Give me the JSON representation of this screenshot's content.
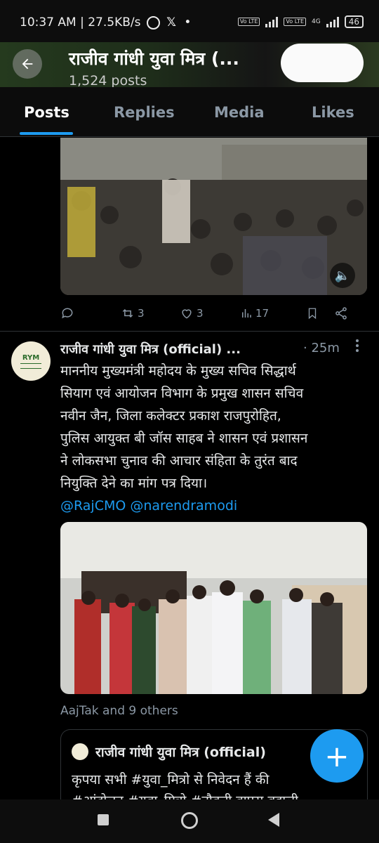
{
  "status_bar": {
    "time_speed": "10:37 AM | 27.5KB/s",
    "whatsapp_icon": "whatsapp-icon",
    "x_icon_glyph": "𝕏",
    "dot": "•",
    "lte1": "Vo LTE",
    "lte2": "Vo LTE",
    "network": "4G",
    "battery": "46"
  },
  "header": {
    "title": "राजीव गांधी युवा मित्र (...",
    "posts_count": "1,524 posts",
    "back_icon": "arrow-left-icon"
  },
  "tabs": [
    {
      "label": "Posts",
      "active": true
    },
    {
      "label": "Replies",
      "active": false
    },
    {
      "label": "Media",
      "active": false
    },
    {
      "label": "Likes",
      "active": false
    }
  ],
  "post1": {
    "reposts": "3",
    "likes": "3",
    "views": "17"
  },
  "post2": {
    "author": "राजीव गांधी युवा मित्र (official) ...",
    "time": "· 25m",
    "text_lines": [
      "माननीय मुख्यमंत्री महोदय के मुख्य सचिव सिद्धार्थ",
      "सियाग एवं आयोजन विभाग के प्रमुख शासन सचिव",
      "नवीन जैन, जिला कलेक्टर प्रकाश राजपुरोहित,",
      "पुलिस आयुक्त बी जॉस साहब ने शासन एवं प्रशासन",
      "ने लोकसभा चुनाव की आचार संहिता के तुरंत बाद",
      "नियुक्ति देने का मांग पत्र दिया।"
    ],
    "mentions": "@RajCMO @narendramodi",
    "liked_by": "AajTak and 9 others",
    "avatar_text": "RYM"
  },
  "quoted": {
    "author": "राजीव गांधी युवा मित्र (official)",
    "text": "कृपया सभी #युवा_मित्रो से निवेदन हैं की",
    "text2": "#आंदोलन #युवा_मित्रो #नौकरी वापस बहाली"
  },
  "fab_label": "+",
  "colors": {
    "accent": "#1d9bf0",
    "background": "#000000",
    "muted": "#8b98a5"
  }
}
